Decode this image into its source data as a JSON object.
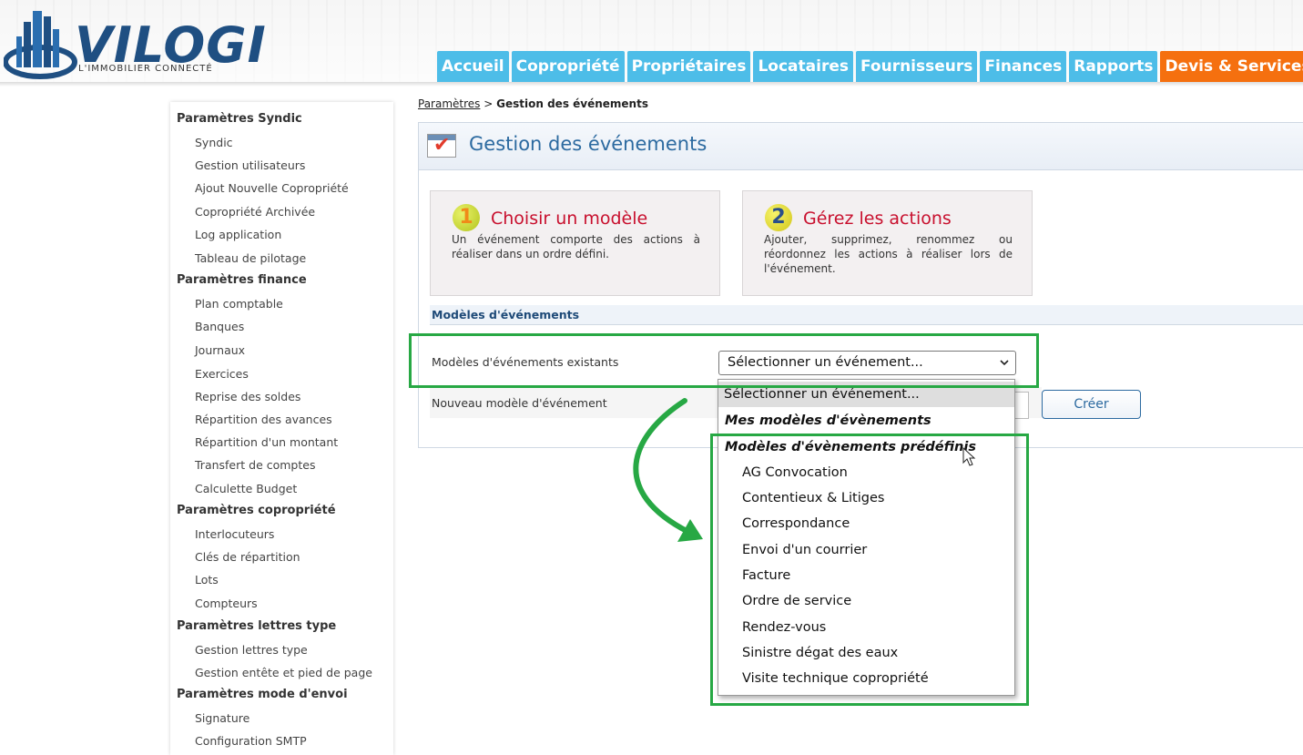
{
  "brand": {
    "name": "VILOGI",
    "tagline": "L'IMMOBILIER CONNECTÉ"
  },
  "nav": {
    "tabs": [
      {
        "label": "Accueil"
      },
      {
        "label": "Copropriété"
      },
      {
        "label": "Propriétaires"
      },
      {
        "label": "Locataires"
      },
      {
        "label": "Fournisseurs"
      },
      {
        "label": "Finances"
      },
      {
        "label": "Rapports"
      },
      {
        "label": "Devis & Services"
      }
    ],
    "active_tab": "Devis & Services"
  },
  "sidebar": {
    "sections": [
      {
        "title": "Paramètres Syndic",
        "items": [
          "Syndic",
          "Gestion utilisateurs",
          "Ajout Nouvelle Copropriété",
          "Copropriété Archivée",
          "Log application",
          "Tableau de pilotage"
        ]
      },
      {
        "title": "Paramètres finance",
        "items": [
          "Plan comptable",
          "Banques",
          "Journaux",
          "Exercices",
          "Reprise des soldes",
          "Répartition des avances",
          "Répartition d'un montant",
          "Transfert de comptes",
          "Calculette Budget"
        ]
      },
      {
        "title": "Paramètres copropriété",
        "items": [
          "Interlocuteurs",
          "Clés de répartition",
          "Lots",
          "Compteurs"
        ]
      },
      {
        "title": "Paramètres lettres type",
        "items": [
          "Gestion lettres type",
          "Gestion entête et pied de page"
        ]
      },
      {
        "title": "Paramètres mode d'envoi",
        "items": [
          "Signature",
          "Configuration SMTP"
        ]
      }
    ]
  },
  "breadcrumb": {
    "parent": "Paramètres",
    "separator": ">",
    "current": "Gestion des événements"
  },
  "page": {
    "title": "Gestion des événements",
    "steps": [
      {
        "number": "1",
        "title": "Choisir un modèle",
        "description": "Un événement comporte des actions à réaliser dans un ordre défini."
      },
      {
        "number": "2",
        "title": "Gérez les actions",
        "description": "Ajouter, supprimez, renommez ou réordonnez les actions à réaliser lors de l'événement."
      }
    ],
    "section_title": "Modèles d'événements",
    "existing_label": "Modèles d'événements existants",
    "select_value": "Sélectionner un événement...",
    "new_label": "Nouveau modèle d'événement",
    "create_button": "Créer"
  },
  "dropdown": {
    "placeholder_option": "Sélectionner un événement...",
    "group_mine": "Mes modèles d'évènements",
    "group_predefined": "Modèles d'évènements prédéfinis",
    "options": [
      "AG Convocation",
      "Contentieux & Litiges",
      "Correspondance",
      "Envoi d'un courrier",
      "Facture",
      "Ordre de service",
      "Rendez-vous",
      "Sinistre dégat des eaux",
      "Visite technique copropriété"
    ]
  },
  "colors": {
    "nav_tab": "#4dbde8",
    "nav_tab_active": "#f5700f",
    "title_blue": "#2c6aa0",
    "step_title_red": "#c8102e",
    "annotation_green": "#27a844"
  },
  "icons": [
    "logo-building-icon",
    "event-calendar-icon",
    "step-1-badge-icon",
    "step-2-badge-icon",
    "chevron-down-icon",
    "mouse-pointer-icon",
    "annotation-arrow-icon"
  ]
}
